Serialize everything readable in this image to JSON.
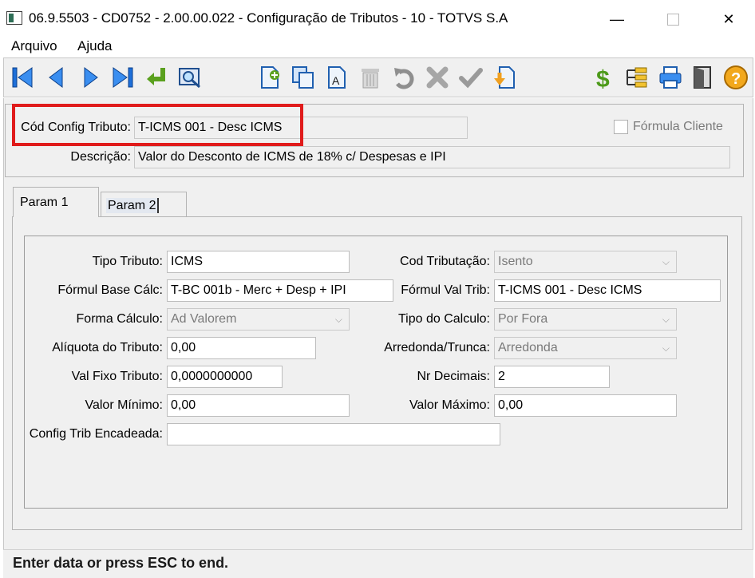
{
  "window": {
    "title": "06.9.5503 - CD0752 - 2.00.00.022 - Configuração de Tributos - 10 - TOTVS S.A",
    "minimize_glyph": "—",
    "close_glyph": "✕"
  },
  "menu": {
    "file": "Arquivo",
    "help": "Ajuda"
  },
  "toolbar": {
    "icons": [
      "first-icon",
      "prev-icon",
      "next-icon",
      "last-icon",
      "goto-icon",
      "search-icon",
      "add-icon",
      "copy-icon",
      "edit-icon",
      "delete-icon",
      "undo-icon",
      "cancel-icon",
      "confirm-icon",
      "import-icon",
      "dollar-icon",
      "hierarchy-icon",
      "print-icon",
      "exit-icon",
      "help-icon"
    ]
  },
  "header": {
    "cod_label": "Cód Config Tributo:",
    "cod_value": "T-ICMS 001 - Desc ICMS",
    "desc_label": "Descrição:",
    "desc_value": "Valor do Desconto de ICMS de 18% c/ Despesas e IPI",
    "formula_label": "Fórmula Cliente",
    "formula_checked": false
  },
  "tabs": {
    "param1": "Param 1",
    "param2": "Param 2",
    "active": "param1"
  },
  "params": {
    "tipo_tributo_label": "Tipo Tributo:",
    "tipo_tributo_value": "ICMS",
    "formul_base_label": "Fórmul Base Cálc:",
    "formul_base_value": "T-BC 001b - Merc + Desp + IPI",
    "forma_calculo_label": "Forma Cálculo:",
    "forma_calculo_value": "Ad Valorem",
    "aliquota_label": "Alíquota do Tributo:",
    "aliquota_value": "0,00",
    "val_fixo_label": "Val Fixo Tributo:",
    "val_fixo_value": "0,0000000000",
    "valor_minimo_label": "Valor Mínimo:",
    "valor_minimo_value": "0,00",
    "config_trib_label": "Config Trib Encadeada:",
    "config_trib_value": "",
    "cod_tributacao_label": "Cod Tributação:",
    "cod_tributacao_value": "Isento",
    "formul_val_label": "Fórmul Val Trib:",
    "formul_val_value": "T-ICMS 001 - Desc ICMS",
    "tipo_calculo_label": "Tipo do Calculo:",
    "tipo_calculo_value": "Por Fora",
    "arredonda_label": "Arredonda/Trunca:",
    "arredonda_value": "Arredonda",
    "nr_decimais_label": "Nr Decimais:",
    "nr_decimais_value": "2",
    "valor_maximo_label": "Valor Máximo:",
    "valor_maximo_value": "0,00"
  },
  "status": {
    "text": "Enter data or press ESC to end."
  },
  "colors": {
    "nav_blue": "#1e6fd9",
    "highlight_red": "#e01b1b",
    "panel_bg": "#f0f0f0"
  }
}
